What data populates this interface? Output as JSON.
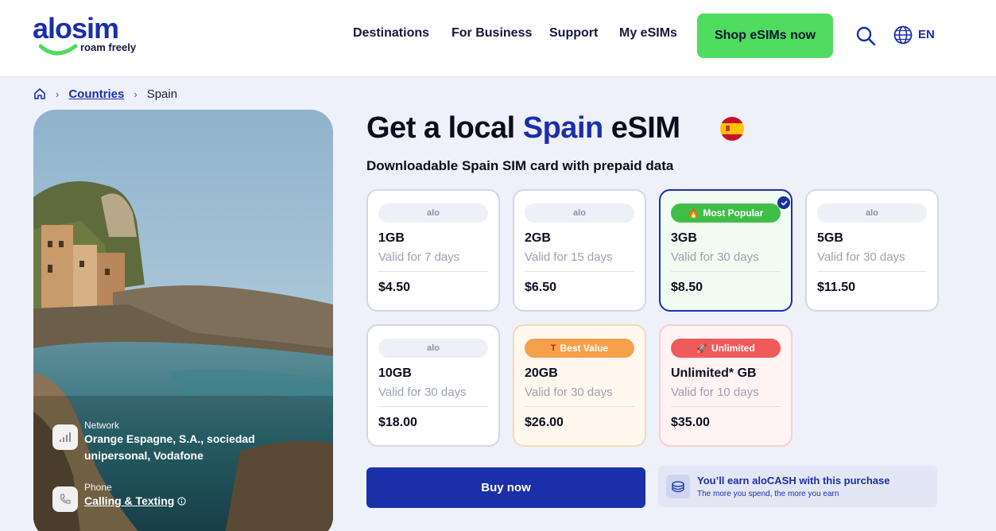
{
  "header": {
    "logo_word": "alosim",
    "logo_tagline": "roam freely",
    "nav": [
      "Destinations",
      "For Business",
      "Support",
      "My eSIMs"
    ],
    "cta": "Shop eSIMs now",
    "language": "EN"
  },
  "breadcrumb": {
    "countries": "Countries",
    "current": "Spain"
  },
  "hero": {
    "title_pre": "Get a local ",
    "title_highlight": "Spain",
    "title_post": " eSIM",
    "subtitle": "Downloadable Spain SIM card with prepaid data"
  },
  "info": {
    "network_label": "Network",
    "network_line1": "Orange Espagne, S.A., sociedad",
    "network_line2": "unipersonal, Vodafone",
    "phone_label": "Phone",
    "phone_value": "Calling & Texting"
  },
  "plans": [
    {
      "badge": "alo",
      "gb": "1GB",
      "valid": "Valid for 7 days",
      "price": "$4.50"
    },
    {
      "badge": "alo",
      "gb": "2GB",
      "valid": "Valid for 15 days",
      "price": "$6.50"
    },
    {
      "badge": "Most Popular",
      "gb": "3GB",
      "valid": "Valid for 30 days",
      "price": "$8.50"
    },
    {
      "badge": "alo",
      "gb": "5GB",
      "valid": "Valid for 30 days",
      "price": "$11.50"
    },
    {
      "badge": "alo",
      "gb": "10GB",
      "valid": "Valid for 30 days",
      "price": "$18.00"
    },
    {
      "badge": "Best Value",
      "gb": "20GB",
      "valid": "Valid for 30 days",
      "price": "$26.00"
    },
    {
      "badge": "Unlimited",
      "gb": "Unlimited* GB",
      "valid": "Valid for 10 days",
      "price": "$35.00"
    }
  ],
  "selected_plan": "3GB",
  "buy_label": "Buy now",
  "alocash": {
    "title": "You’ll earn aloCASH with this purchase",
    "subtitle": "The more you spend, the more you earn"
  },
  "colors": {
    "brand_blue": "#1a2fa8",
    "cta_green": "#4fdc5f",
    "popular_green": "#3fbf48",
    "best_orange": "#f7a04a",
    "unlimited_red": "#f05a5a"
  }
}
